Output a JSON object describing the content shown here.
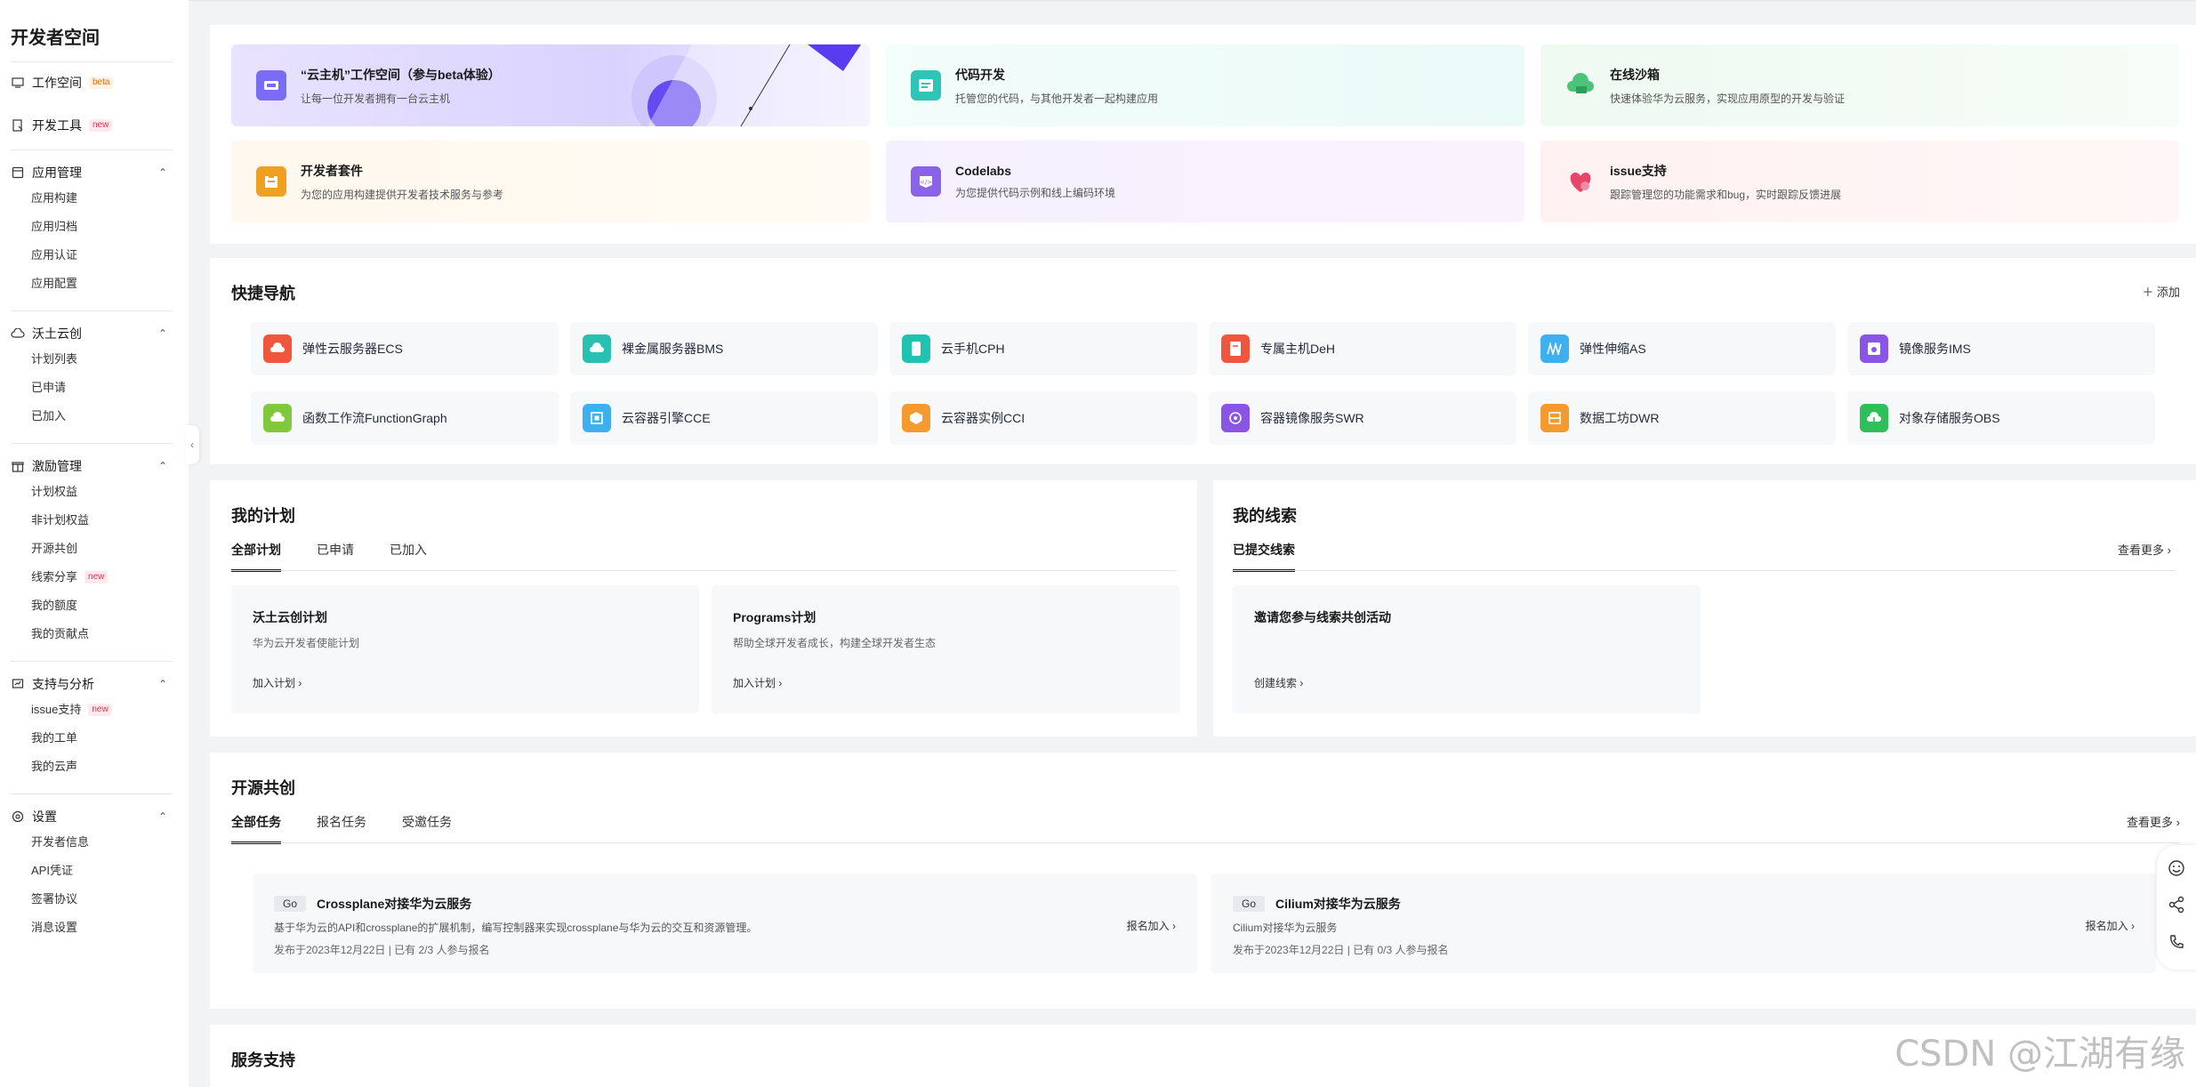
{
  "sidebar": {
    "title": "开发者空间",
    "top_items": [
      {
        "label": "工作空间",
        "tag": "beta"
      },
      {
        "label": "开发工具",
        "tag": "new"
      }
    ],
    "groups": [
      {
        "label": "应用管理",
        "items": [
          {
            "label": "应用构建"
          },
          {
            "label": "应用归档"
          },
          {
            "label": "应用认证"
          },
          {
            "label": "应用配置"
          }
        ]
      },
      {
        "label": "沃土云创",
        "items": [
          {
            "label": "计划列表"
          },
          {
            "label": "已申请"
          },
          {
            "label": "已加入"
          }
        ]
      },
      {
        "label": "激励管理",
        "items": [
          {
            "label": "计划权益"
          },
          {
            "label": "非计划权益"
          },
          {
            "label": "开源共创"
          },
          {
            "label": "线索分享",
            "tag": "new"
          },
          {
            "label": "我的额度"
          },
          {
            "label": "我的贡献点"
          }
        ]
      },
      {
        "label": "支持与分析",
        "items": [
          {
            "label": "issue支持",
            "tag": "new"
          },
          {
            "label": "我的工单"
          },
          {
            "label": "我的云声"
          }
        ]
      },
      {
        "label": "设置",
        "items": [
          {
            "label": "开发者信息"
          },
          {
            "label": "API凭证"
          },
          {
            "label": "签署协议"
          },
          {
            "label": "消息设置"
          }
        ]
      }
    ]
  },
  "banners": [
    {
      "title": "“云主机”工作空间（参与beta体验）",
      "desc": "让每一位开发者拥有一台云主机",
      "icon": "cloud-host-icon",
      "color": "#6b5cf6"
    },
    {
      "title": "代码开发",
      "desc": "托管您的代码，与其他开发者一起构建应用",
      "icon": "code-dev-icon",
      "color": "#2ec4b6"
    },
    {
      "title": "在线沙箱",
      "desc": "快速体验华为云服务，实现应用原型的开发与验证",
      "icon": "sandbox-icon",
      "color": "#4cc37a"
    },
    {
      "title": "开发者套件",
      "desc": "为您的应用构建提供开发者技术服务与参考",
      "icon": "toolkit-icon",
      "color": "#f0a020"
    },
    {
      "title": "Codelabs",
      "desc": "为您提供代码示例和线上编码环境",
      "icon": "codelabs-icon",
      "color": "#8a63e8"
    },
    {
      "title": "issue支持",
      "desc": "跟踪管理您的功能需求和bug，实时跟踪反馈进展",
      "icon": "issue-heart-icon",
      "color": "#e8456a"
    }
  ],
  "quick_nav": {
    "title": "快捷导航",
    "add_label": "添加",
    "items": [
      {
        "label": "弹性云服务器ECS",
        "color": "#f0553e"
      },
      {
        "label": "裸金属服务器BMS",
        "color": "#28c0b0"
      },
      {
        "label": "云手机CPH",
        "color": "#1fc3b0"
      },
      {
        "label": "专属主机DeH",
        "color": "#f0553e"
      },
      {
        "label": "弹性伸缩AS",
        "color": "#3eb0f0"
      },
      {
        "label": "镜像服务IMS",
        "color": "#8a55e6"
      },
      {
        "label": "函数工作流FunctionGraph",
        "color": "#7fc93b"
      },
      {
        "label": "云容器引擎CCE",
        "color": "#3eb0f0"
      },
      {
        "label": "云容器实例CCI",
        "color": "#f59a2e"
      },
      {
        "label": "容器镜像服务SWR",
        "color": "#8a55e6"
      },
      {
        "label": "数据工坊DWR",
        "color": "#f59a2e"
      },
      {
        "label": "对象存储服务OBS",
        "color": "#2fbf5a"
      }
    ]
  },
  "my_plans": {
    "title": "我的计划",
    "tabs": [
      "全部计划",
      "已申请",
      "已加入"
    ],
    "cards": [
      {
        "title": "沃土云创计划",
        "desc": "华为云开发者使能计划",
        "link": "加入计划"
      },
      {
        "title": "Programs计划",
        "desc": "帮助全球开发者成长，构建全球开发者生态",
        "link": "加入计划"
      }
    ]
  },
  "my_leads": {
    "title": "我的线索",
    "tab": "已提交线索",
    "more": "查看更多",
    "card_title": "邀请您参与线索共创活动",
    "card_link": "创建线索"
  },
  "open_source": {
    "title": "开源共创",
    "tabs": [
      "全部任务",
      "报名任务",
      "受邀任务"
    ],
    "more": "查看更多",
    "tasks": [
      {
        "lang": "Go",
        "title": "Crossplane对接华为云服务",
        "desc": "基于华为云的API和crossplane的扩展机制，编写控制器来实现crossplane与华为云的交互和资源管理。",
        "meta": "发布于2023年12月22日 | 已有 2/3 人参与报名",
        "cta": "报名加入"
      },
      {
        "lang": "Go",
        "title": "Cilium对接华为云服务",
        "desc": "Cilium对接华为云服务",
        "meta": "发布于2023年12月22日 | 已有 0/3 人参与报名",
        "cta": "报名加入"
      }
    ]
  },
  "service_support": {
    "title": "服务支持"
  },
  "watermark": "CSDN @江湖有缘"
}
